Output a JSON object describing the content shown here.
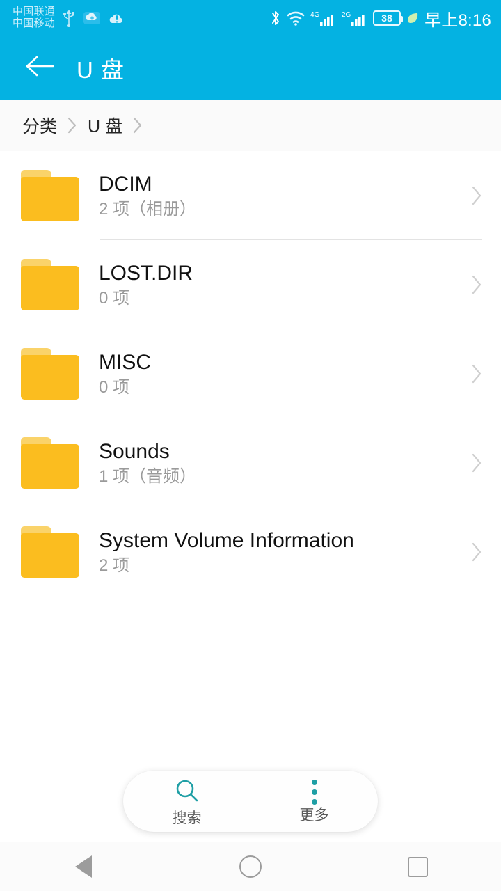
{
  "status_bar": {
    "carriers": [
      "中国联通",
      "中国移动"
    ],
    "icons": [
      "usb-icon",
      "cloud-sync-icon",
      "cloud-alert-icon",
      "bluetooth-icon",
      "wifi-icon"
    ],
    "network_4g_label": "4G",
    "network_2g_label": "2G",
    "battery_percent": "38",
    "eco_icon": "leaf-icon",
    "time": "早上8:16",
    "background_color": "#04B2E2"
  },
  "app_bar": {
    "back_icon": "arrow-left-icon",
    "title": "U 盘",
    "background_color": "#04B2E2"
  },
  "breadcrumb": {
    "items": [
      "分类",
      "U 盘"
    ],
    "separator_icon": "chevron-right-icon"
  },
  "file_list": [
    {
      "name": "DCIM",
      "detail": "2 项（相册）",
      "icon": "folder-icon",
      "chevron": "chevron-right-icon"
    },
    {
      "name": "LOST.DIR",
      "detail": "0 项",
      "icon": "folder-icon",
      "chevron": "chevron-right-icon"
    },
    {
      "name": "MISC",
      "detail": "0 项",
      "icon": "folder-icon",
      "chevron": "chevron-right-icon"
    },
    {
      "name": "Sounds",
      "detail": "1 项（音频）",
      "icon": "folder-icon",
      "chevron": "chevron-right-icon"
    },
    {
      "name": "System Volume Information",
      "detail": "2 项",
      "icon": "folder-icon",
      "chevron": "chevron-right-icon"
    }
  ],
  "bottom_bar": {
    "search": {
      "label": "搜索",
      "icon": "search-icon"
    },
    "more": {
      "label": "更多",
      "icon": "more-vertical-icon"
    },
    "accent_color": "#1F9FA5"
  },
  "nav_bar": {
    "back": "back-triangle-icon",
    "home": "home-circle-icon",
    "recents": "recents-square-icon"
  },
  "colors": {
    "folder_body": "#FBBD1F",
    "folder_tab": "#FAD36A",
    "header": "#04B2E2",
    "teal": "#1F9FA5"
  }
}
